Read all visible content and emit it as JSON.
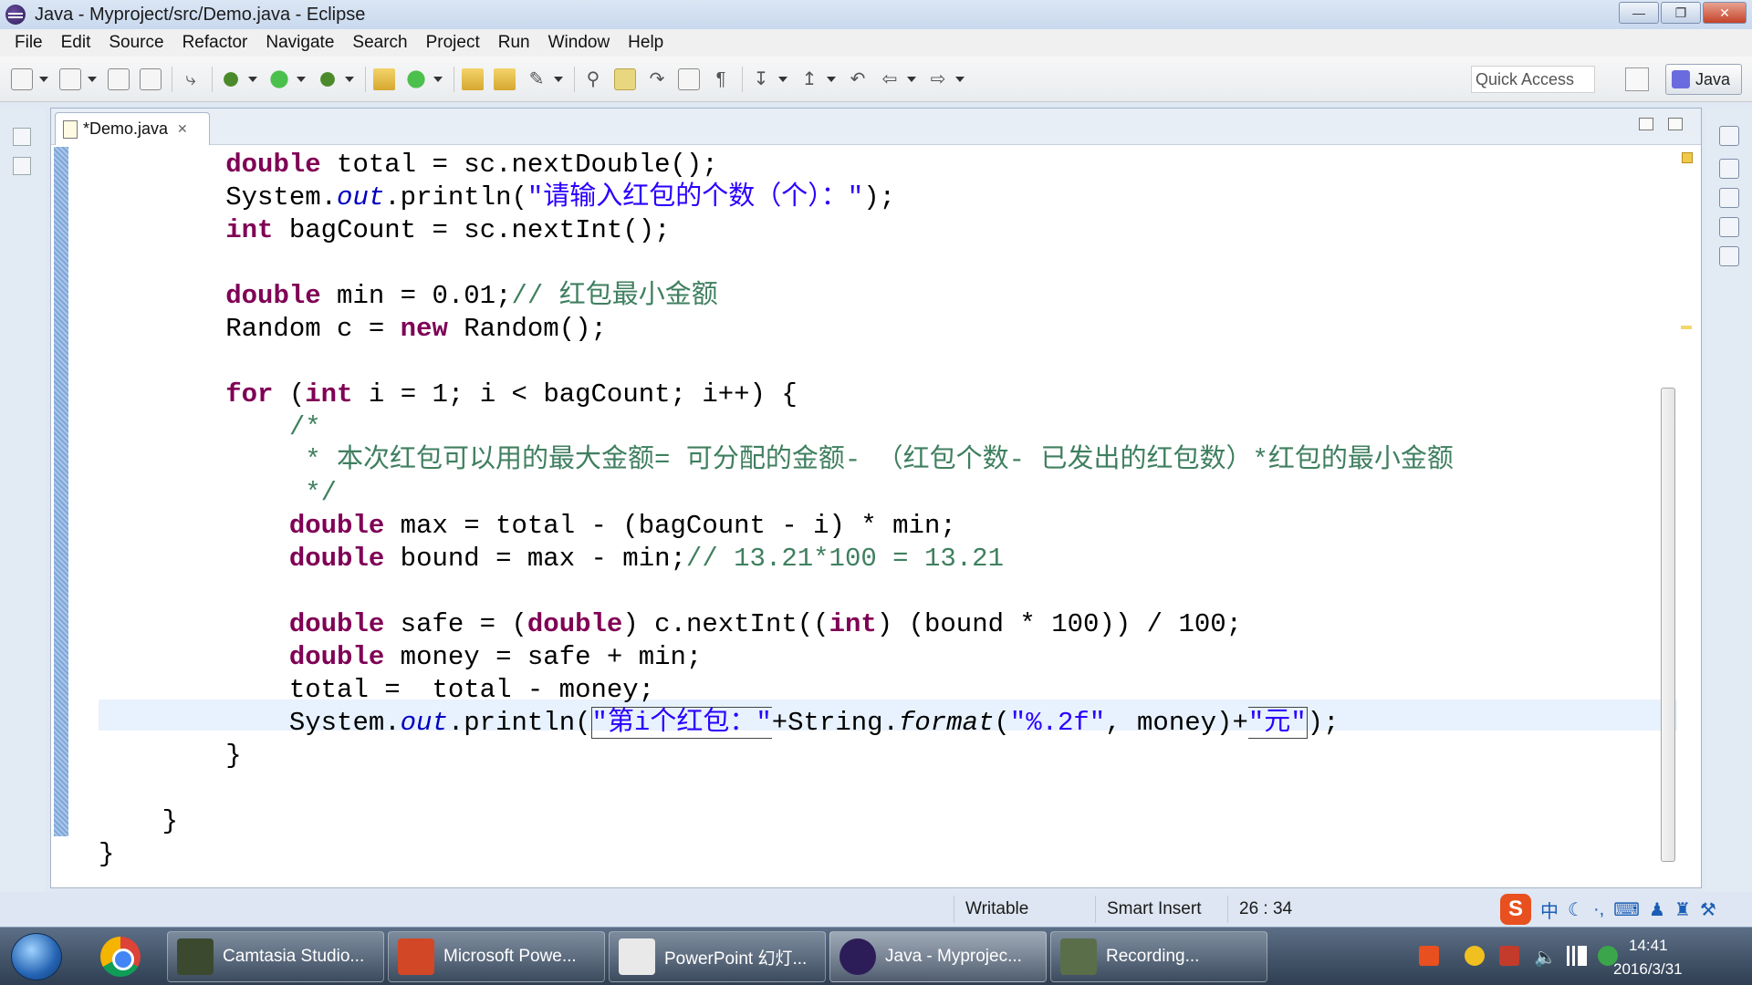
{
  "window": {
    "title": "Java - Myproject/src/Demo.java - Eclipse"
  },
  "menu": [
    "File",
    "Edit",
    "Source",
    "Refactor",
    "Navigate",
    "Search",
    "Project",
    "Run",
    "Window",
    "Help"
  ],
  "toolbar": {
    "quick_access_placeholder": "Quick Access",
    "perspective_label": "Java"
  },
  "editor": {
    "tab_label": "*Demo.java",
    "code_lines": [
      [
        {
          "t": "        "
        },
        {
          "t": "double",
          "c": "kw"
        },
        {
          "t": " total = sc.nextDouble();"
        }
      ],
      [
        {
          "t": "        System."
        },
        {
          "t": "out",
          "c": "sf"
        },
        {
          "t": ".println("
        },
        {
          "t": "\"请输入红包的个数（个）：\"",
          "c": "str"
        },
        {
          "t": ");"
        }
      ],
      [
        {
          "t": "        "
        },
        {
          "t": "int",
          "c": "kw"
        },
        {
          "t": " bagCount = sc.nextInt();"
        }
      ],
      [
        {
          "t": ""
        }
      ],
      [
        {
          "t": "        "
        },
        {
          "t": "double",
          "c": "kw"
        },
        {
          "t": " min = 0.01;"
        },
        {
          "t": "// 红包最小金额",
          "c": "cm"
        }
      ],
      [
        {
          "t": "        Random c = "
        },
        {
          "t": "new",
          "c": "kw"
        },
        {
          "t": " Random();"
        }
      ],
      [
        {
          "t": ""
        }
      ],
      [
        {
          "t": "        "
        },
        {
          "t": "for",
          "c": "kw"
        },
        {
          "t": " ("
        },
        {
          "t": "int",
          "c": "kw"
        },
        {
          "t": " i = 1; i < bagCount; i++) {"
        }
      ],
      [
        {
          "t": "            "
        },
        {
          "t": "/*",
          "c": "cm"
        }
      ],
      [
        {
          "t": "             "
        },
        {
          "t": "* 本次红包可以用的最大金额= 可分配的金额- （红包个数- 已发出的红包数）*红包的最小金额",
          "c": "cm"
        }
      ],
      [
        {
          "t": "             "
        },
        {
          "t": "*/",
          "c": "cm"
        }
      ],
      [
        {
          "t": "            "
        },
        {
          "t": "double",
          "c": "kw"
        },
        {
          "t": " max = total - (bagCount - i) * min;"
        }
      ],
      [
        {
          "t": "            "
        },
        {
          "t": "double",
          "c": "kw"
        },
        {
          "t": " bound = max - min;"
        },
        {
          "t": "// 13.21*100 = 13.21",
          "c": "cm"
        }
      ],
      [
        {
          "t": ""
        }
      ],
      [
        {
          "t": "            "
        },
        {
          "t": "double",
          "c": "kw"
        },
        {
          "t": " safe = ("
        },
        {
          "t": "double",
          "c": "kw"
        },
        {
          "t": ") c.nextInt(("
        },
        {
          "t": "int",
          "c": "kw"
        },
        {
          "t": ") (bound * 100)) / 100;"
        }
      ],
      [
        {
          "t": "            "
        },
        {
          "t": "double",
          "c": "kw"
        },
        {
          "t": " money = safe + min;"
        }
      ],
      [
        {
          "t": "            total =  total - money;"
        }
      ],
      [
        {
          "t": "            System."
        },
        {
          "t": "out",
          "c": "sf"
        },
        {
          "t": ".println("
        },
        {
          "t": "\"第i个红包：\"",
          "c": "str sel-start"
        },
        {
          "t": "+String."
        },
        {
          "t": "format",
          "c": "it"
        },
        {
          "t": "("
        },
        {
          "t": "\"%.2f\"",
          "c": "str"
        },
        {
          "t": ", money)+"
        },
        {
          "t": "\"元\"",
          "c": "str sel-end"
        },
        {
          "t": ");"
        }
      ],
      [
        {
          "t": "        }"
        }
      ],
      [
        {
          "t": ""
        }
      ],
      [
        {
          "t": "    }"
        }
      ],
      [
        {
          "t": "}"
        }
      ]
    ]
  },
  "status": {
    "mode": "Writable",
    "insert": "Smart Insert",
    "position": "26 : 34"
  },
  "ime": {
    "logo": "S",
    "lang": "中"
  },
  "taskbar": {
    "items": [
      {
        "label": "Camtasia Studio...",
        "color": "#3b4a2e"
      },
      {
        "label": "Microsoft Powe...",
        "color": "#d24726"
      },
      {
        "label": "PowerPoint 幻灯...",
        "color": "#e9e9e9"
      },
      {
        "label": "Java - Myprojec...",
        "color": "#2c1c57"
      },
      {
        "label": "Recording...",
        "color": "#5a6e4a"
      }
    ],
    "time": "14:41",
    "date": "2016/3/31"
  }
}
